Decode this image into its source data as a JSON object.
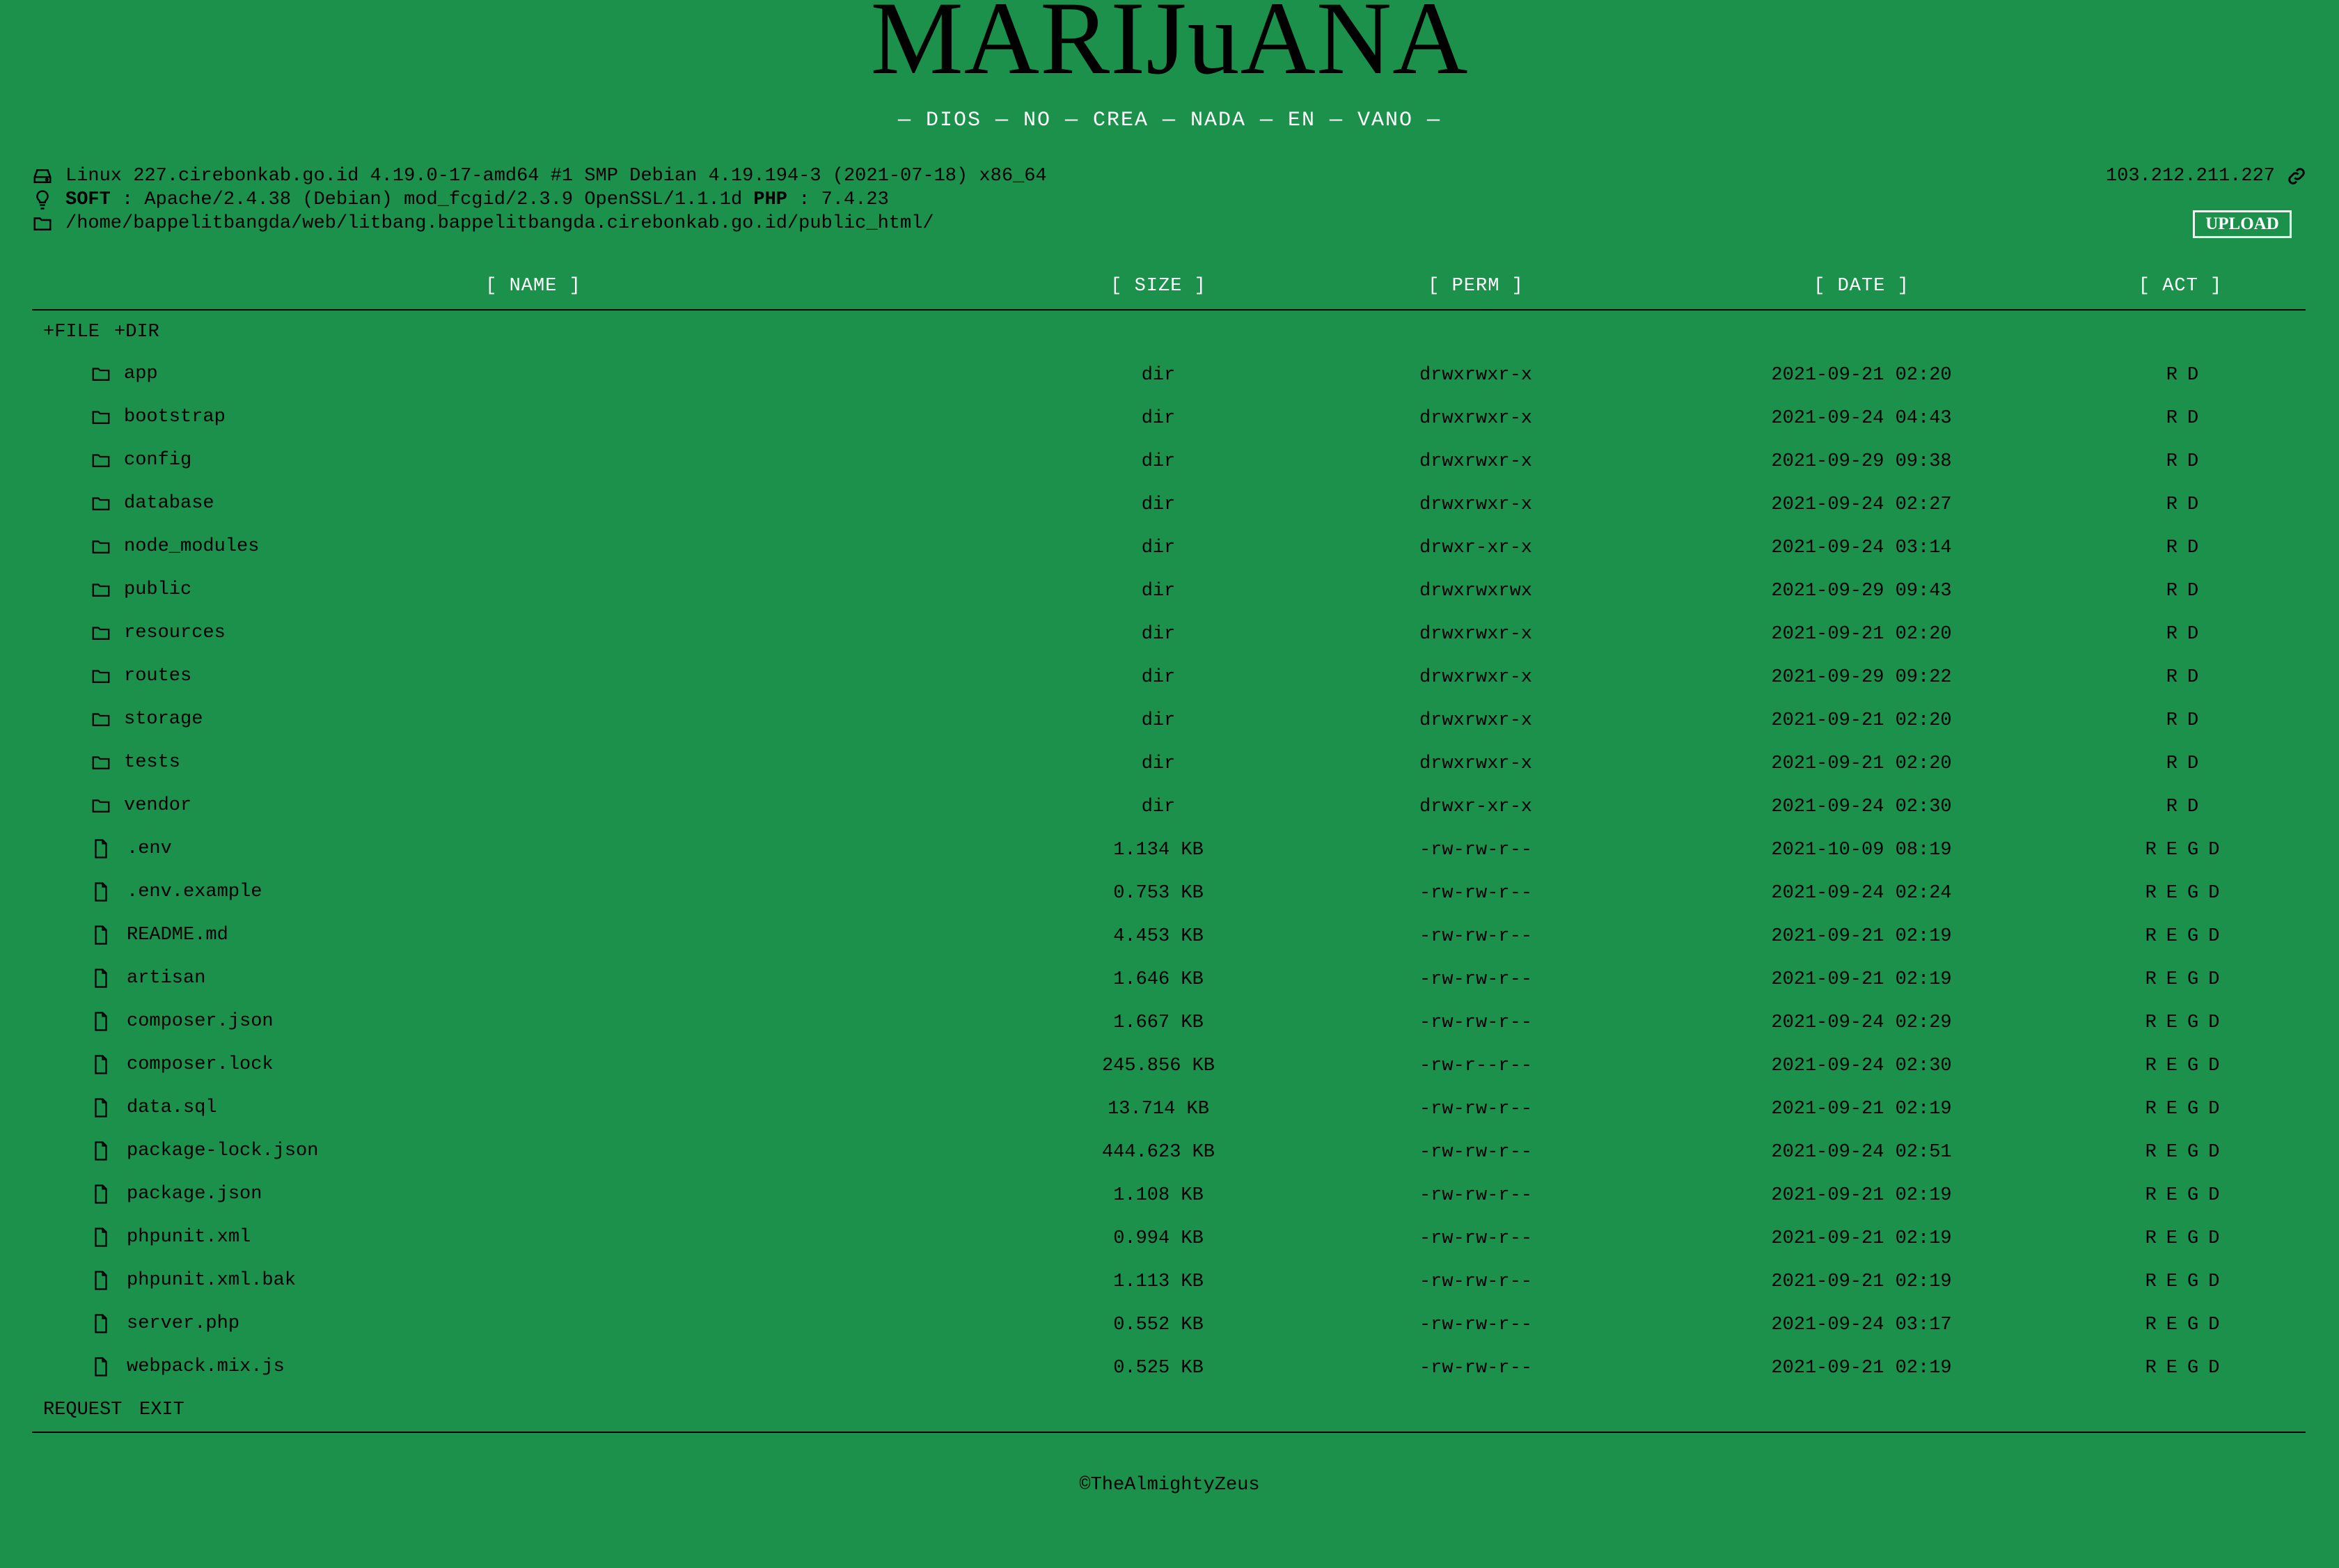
{
  "header": {
    "logo": "MARIJuANA",
    "tagline": "— DIOS — NO — CREA — NADA — EN — VANO —"
  },
  "system": {
    "uname": "Linux 227.cirebonkab.go.id 4.19.0-17-amd64 #1 SMP Debian 4.19.194-3 (2021-07-18) x86_64",
    "soft_label": "SOFT",
    "soft_value": ": Apache/2.4.38 (Debian) mod_fcgid/2.3.9 OpenSSL/1.1.1d",
    "php_label": "PHP",
    "php_value": ": 7.4.23",
    "path": "/home/bappelitbangda/web/litbang.bappelitbangda.cirebonkab.go.id/public_html/",
    "ip": "103.212.211.227"
  },
  "upload_label": "UPLOAD",
  "columns": {
    "name": "[ NAME ]",
    "size": "[ SIZE ]",
    "perm": "[ PERM ]",
    "date": "[ DATE ]",
    "act": "[ ACT ]"
  },
  "actions": {
    "new_file": "+FILE",
    "new_dir": "+DIR"
  },
  "entries": [
    {
      "type": "dir",
      "name": "app",
      "size": "dir",
      "perm": "drwxrwxr-x",
      "date": "2021-09-21 02:20",
      "act": [
        "R",
        "D"
      ]
    },
    {
      "type": "dir",
      "name": "bootstrap",
      "size": "dir",
      "perm": "drwxrwxr-x",
      "date": "2021-09-24 04:43",
      "act": [
        "R",
        "D"
      ]
    },
    {
      "type": "dir",
      "name": "config",
      "size": "dir",
      "perm": "drwxrwxr-x",
      "date": "2021-09-29 09:38",
      "act": [
        "R",
        "D"
      ]
    },
    {
      "type": "dir",
      "name": "database",
      "size": "dir",
      "perm": "drwxrwxr-x",
      "date": "2021-09-24 02:27",
      "act": [
        "R",
        "D"
      ]
    },
    {
      "type": "dir",
      "name": "node_modules",
      "size": "dir",
      "perm": "drwxr-xr-x",
      "date": "2021-09-24 03:14",
      "act": [
        "R",
        "D"
      ]
    },
    {
      "type": "dir",
      "name": "public",
      "size": "dir",
      "perm": "drwxrwxrwx",
      "date": "2021-09-29 09:43",
      "act": [
        "R",
        "D"
      ]
    },
    {
      "type": "dir",
      "name": "resources",
      "size": "dir",
      "perm": "drwxrwxr-x",
      "date": "2021-09-21 02:20",
      "act": [
        "R",
        "D"
      ]
    },
    {
      "type": "dir",
      "name": "routes",
      "size": "dir",
      "perm": "drwxrwxr-x",
      "date": "2021-09-29 09:22",
      "act": [
        "R",
        "D"
      ]
    },
    {
      "type": "dir",
      "name": "storage",
      "size": "dir",
      "perm": "drwxrwxr-x",
      "date": "2021-09-21 02:20",
      "act": [
        "R",
        "D"
      ]
    },
    {
      "type": "dir",
      "name": "tests",
      "size": "dir",
      "perm": "drwxrwxr-x",
      "date": "2021-09-21 02:20",
      "act": [
        "R",
        "D"
      ]
    },
    {
      "type": "dir",
      "name": "vendor",
      "size": "dir",
      "perm": "drwxr-xr-x",
      "date": "2021-09-24 02:30",
      "act": [
        "R",
        "D"
      ]
    },
    {
      "type": "file",
      "name": ".env",
      "size": "1.134 KB",
      "perm": "-rw-rw-r--",
      "date": "2021-10-09 08:19",
      "act": [
        "R",
        "E",
        "G",
        "D"
      ]
    },
    {
      "type": "file",
      "name": ".env.example",
      "size": "0.753 KB",
      "perm": "-rw-rw-r--",
      "date": "2021-09-24 02:24",
      "act": [
        "R",
        "E",
        "G",
        "D"
      ]
    },
    {
      "type": "file",
      "name": "README.md",
      "size": "4.453 KB",
      "perm": "-rw-rw-r--",
      "date": "2021-09-21 02:19",
      "act": [
        "R",
        "E",
        "G",
        "D"
      ]
    },
    {
      "type": "file",
      "name": "artisan",
      "size": "1.646 KB",
      "perm": "-rw-rw-r--",
      "date": "2021-09-21 02:19",
      "act": [
        "R",
        "E",
        "G",
        "D"
      ]
    },
    {
      "type": "file",
      "name": "composer.json",
      "size": "1.667 KB",
      "perm": "-rw-rw-r--",
      "date": "2021-09-24 02:29",
      "act": [
        "R",
        "E",
        "G",
        "D"
      ]
    },
    {
      "type": "file",
      "name": "composer.lock",
      "size": "245.856 KB",
      "perm": "-rw-r--r--",
      "date": "2021-09-24 02:30",
      "act": [
        "R",
        "E",
        "G",
        "D"
      ]
    },
    {
      "type": "file",
      "name": "data.sql",
      "size": "13.714 KB",
      "perm": "-rw-rw-r--",
      "date": "2021-09-21 02:19",
      "act": [
        "R",
        "E",
        "G",
        "D"
      ]
    },
    {
      "type": "file",
      "name": "package-lock.json",
      "size": "444.623 KB",
      "perm": "-rw-rw-r--",
      "date": "2021-09-24 02:51",
      "act": [
        "R",
        "E",
        "G",
        "D"
      ]
    },
    {
      "type": "file",
      "name": "package.json",
      "size": "1.108 KB",
      "perm": "-rw-rw-r--",
      "date": "2021-09-21 02:19",
      "act": [
        "R",
        "E",
        "G",
        "D"
      ]
    },
    {
      "type": "file",
      "name": "phpunit.xml",
      "size": "0.994 KB",
      "perm": "-rw-rw-r--",
      "date": "2021-09-21 02:19",
      "act": [
        "R",
        "E",
        "G",
        "D"
      ]
    },
    {
      "type": "file",
      "name": "phpunit.xml.bak",
      "size": "1.113 KB",
      "perm": "-rw-rw-r--",
      "date": "2021-09-21 02:19",
      "act": [
        "R",
        "E",
        "G",
        "D"
      ]
    },
    {
      "type": "file",
      "name": "server.php",
      "size": "0.552 KB",
      "perm": "-rw-rw-r--",
      "date": "2021-09-24 03:17",
      "act": [
        "R",
        "E",
        "G",
        "D"
      ]
    },
    {
      "type": "file",
      "name": "webpack.mix.js",
      "size": "0.525 KB",
      "perm": "-rw-rw-r--",
      "date": "2021-09-21 02:19",
      "act": [
        "R",
        "E",
        "G",
        "D"
      ]
    }
  ],
  "bottom_actions": {
    "request": "REQUEST",
    "exit": "EXIT"
  },
  "footer": "©TheAlmightyZeus",
  "colors": {
    "background": "#1b914b",
    "header_text": "#ffffff",
    "text": "#000000"
  }
}
